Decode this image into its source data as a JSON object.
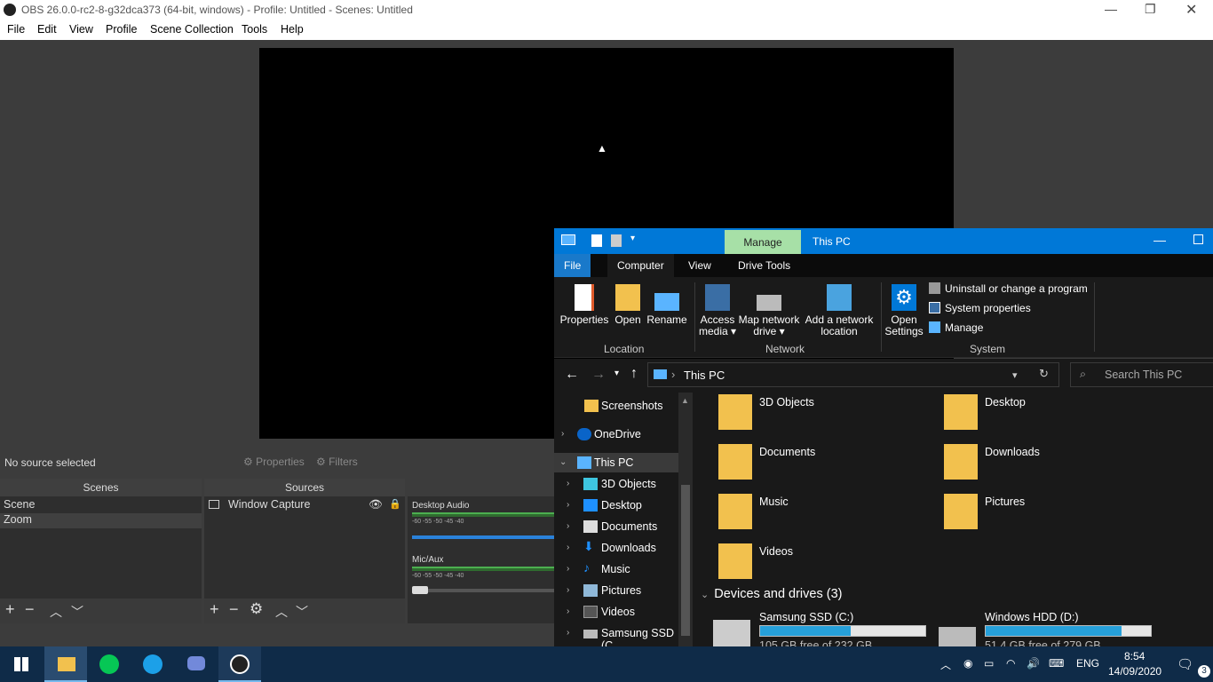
{
  "obs": {
    "title": "OBS 26.0.0-rc2-8-g32dca373 (64-bit, windows) - Profile: Untitled - Scenes: Untitled",
    "menu": [
      "File",
      "Edit",
      "View",
      "Profile",
      "Scene Collection",
      "Tools",
      "Help"
    ],
    "no_source": "No source selected",
    "properties": "Properties",
    "filters": "Filters",
    "scenes_header": "Scenes",
    "scenes": [
      "Scene",
      "Zoom"
    ],
    "sources_header": "Sources",
    "sources": [
      "Window Capture"
    ],
    "mixer": [
      {
        "label": "Desktop Audio",
        "ticks": "-60    -55    -50    -45    -40"
      },
      {
        "label": "Mic/Aux",
        "ticks": "-60    -55    -50    -45    -40"
      }
    ]
  },
  "explorer": {
    "manage": "Manage",
    "title": "This PC",
    "tabs": [
      "File",
      "Computer",
      "View",
      "Drive Tools"
    ],
    "ribbon": {
      "properties": "Properties",
      "open": "Open",
      "rename": "Rename",
      "access_media": "Access media ▾",
      "map_drive": "Map network drive ▾",
      "add_location": "Add a network location",
      "open_settings": "Open Settings",
      "uninstall": "Uninstall or change a program",
      "system_props": "System properties",
      "manage": "Manage",
      "group_location": "Location",
      "group_network": "Network",
      "group_system": "System"
    },
    "address": "This PC",
    "search_placeholder": "Search This PC",
    "nav": [
      "Screenshots",
      "OneDrive",
      "This PC",
      "3D Objects",
      "Desktop",
      "Documents",
      "Downloads",
      "Music",
      "Pictures",
      "Videos",
      "Samsung SSD (C"
    ],
    "folders": [
      "3D Objects",
      "Desktop",
      "Documents",
      "Downloads",
      "Music",
      "Pictures",
      "Videos"
    ],
    "devices_header": "Devices and drives (3)",
    "drives": [
      {
        "name": "Samsung SSD (C:)",
        "free": "105 GB free of 232 GB",
        "used_fraction": 0.55
      },
      {
        "name": "Windows HDD (D:)",
        "free": "51.4 GB free of 279 GB",
        "used_fraction": 0.82
      }
    ]
  },
  "taskbar": {
    "lang": "ENG",
    "time": "8:54",
    "date": "14/09/2020",
    "notifications": "3"
  }
}
